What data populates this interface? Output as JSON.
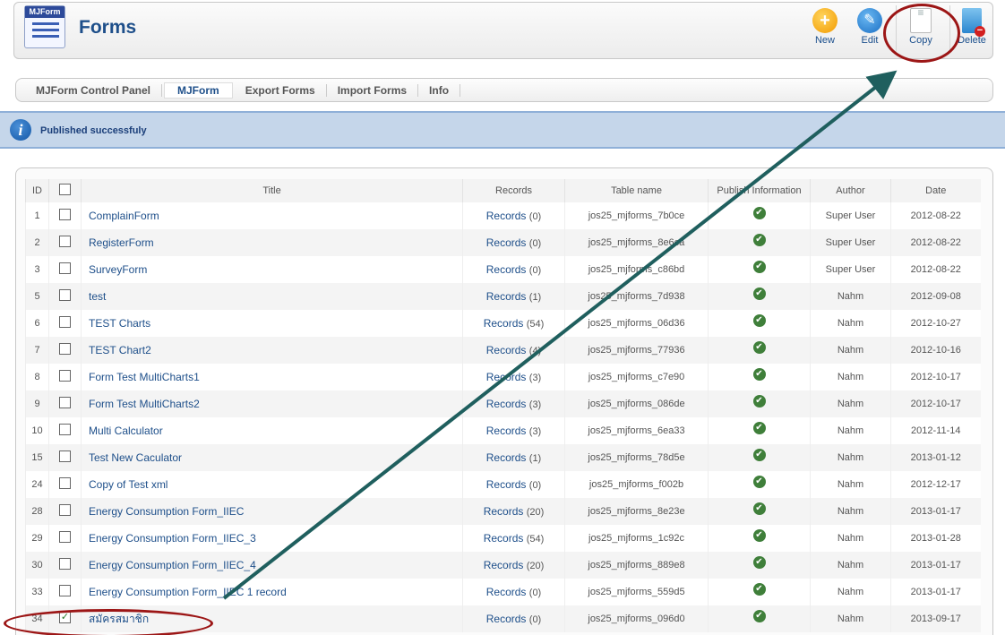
{
  "header": {
    "logo_text": "MJForm",
    "title": "Forms",
    "buttons": [
      {
        "label": "New",
        "icon": "plus-icon"
      },
      {
        "label": "Edit",
        "icon": "pencil-icon"
      },
      {
        "label": "Copy",
        "icon": "copy-icon"
      },
      {
        "label": "Delete",
        "icon": "trash-icon"
      }
    ]
  },
  "submenu": {
    "items": [
      {
        "label": "MJForm Control Panel"
      },
      {
        "label": "MJForm",
        "active": true
      },
      {
        "label": "Export Forms"
      },
      {
        "label": "Import Forms"
      },
      {
        "label": "Info"
      }
    ]
  },
  "message": {
    "text": "Published successfuly",
    "icon": "info-icon"
  },
  "table": {
    "columns": [
      "ID",
      "",
      "Title",
      "Records",
      "Table name",
      "Publish Information",
      "Author",
      "Date"
    ],
    "records_link": "Records",
    "rows": [
      {
        "id": "1",
        "title": "ComplainForm",
        "records": "(0)",
        "table": "jos25_mjforms_7b0ce",
        "author": "Super User",
        "date": "2012-08-22",
        "checked": false
      },
      {
        "id": "2",
        "title": "RegisterForm",
        "records": "(0)",
        "table": "jos25_mjforms_8e6ca",
        "author": "Super User",
        "date": "2012-08-22",
        "checked": false
      },
      {
        "id": "3",
        "title": "SurveyForm",
        "records": "(0)",
        "table": "jos25_mjforms_c86bd",
        "author": "Super User",
        "date": "2012-08-22",
        "checked": false
      },
      {
        "id": "5",
        "title": "test",
        "records": "(1)",
        "table": "jos25_mjforms_7d938",
        "author": "Nahm",
        "date": "2012-09-08",
        "checked": false
      },
      {
        "id": "6",
        "title": "TEST Charts",
        "records": "(54)",
        "table": "jos25_mjforms_06d36",
        "author": "Nahm",
        "date": "2012-10-27",
        "checked": false
      },
      {
        "id": "7",
        "title": "TEST Chart2",
        "records": "(4)",
        "table": "jos25_mjforms_77936",
        "author": "Nahm",
        "date": "2012-10-16",
        "checked": false
      },
      {
        "id": "8",
        "title": "Form Test MultiCharts1",
        "records": "(3)",
        "table": "jos25_mjforms_c7e90",
        "author": "Nahm",
        "date": "2012-10-17",
        "checked": false
      },
      {
        "id": "9",
        "title": "Form Test MultiCharts2",
        "records": "(3)",
        "table": "jos25_mjforms_086de",
        "author": "Nahm",
        "date": "2012-10-17",
        "checked": false
      },
      {
        "id": "10",
        "title": "Multi Calculator",
        "records": "(3)",
        "table": "jos25_mjforms_6ea33",
        "author": "Nahm",
        "date": "2012-11-14",
        "checked": false
      },
      {
        "id": "15",
        "title": "Test New Caculator",
        "records": "(1)",
        "table": "jos25_mjforms_78d5e",
        "author": "Nahm",
        "date": "2013-01-12",
        "checked": false
      },
      {
        "id": "24",
        "title": "Copy of Test xml",
        "records": "(0)",
        "table": "jos25_mjforms_f002b",
        "author": "Nahm",
        "date": "2012-12-17",
        "checked": false
      },
      {
        "id": "28",
        "title": "Energy Consumption Form_IIEC",
        "records": "(20)",
        "table": "jos25_mjforms_8e23e",
        "author": "Nahm",
        "date": "2013-01-17",
        "checked": false
      },
      {
        "id": "29",
        "title": "Energy Consumption Form_IIEC_3",
        "records": "(54)",
        "table": "jos25_mjforms_1c92c",
        "author": "Nahm",
        "date": "2013-01-28",
        "checked": false
      },
      {
        "id": "30",
        "title": "Energy Consumption Form_IIEC_4",
        "records": "(20)",
        "table": "jos25_mjforms_889e8",
        "author": "Nahm",
        "date": "2013-01-17",
        "checked": false
      },
      {
        "id": "33",
        "title": "Energy Consumption Form_IIEC 1 record",
        "records": "(0)",
        "table": "jos25_mjforms_559d5",
        "author": "Nahm",
        "date": "2013-01-17",
        "checked": false
      },
      {
        "id": "34",
        "title": "สมัครสมาชิก",
        "records": "(0)",
        "table": "jos25_mjforms_096d0",
        "author": "Nahm",
        "date": "2013-09-17",
        "checked": true
      }
    ]
  },
  "colors": {
    "accent": "#1e4f8a",
    "highlight_oval": "#9c1616",
    "arrow": "#1f5f5e"
  }
}
